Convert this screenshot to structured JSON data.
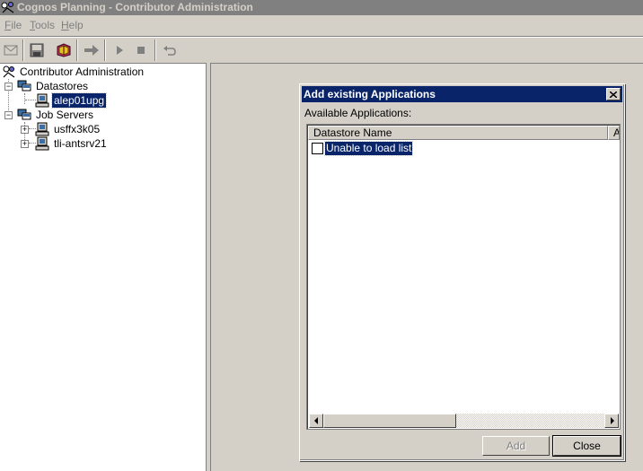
{
  "window": {
    "title": "Cognos Planning - Contributor Administration"
  },
  "menu": {
    "items": [
      {
        "label": "File",
        "accel": "F",
        "rest": "ile"
      },
      {
        "label": "Tools",
        "accel": "T",
        "rest": "ools"
      },
      {
        "label": "Help",
        "accel": "H",
        "rest": "elp"
      }
    ]
  },
  "toolbar": {
    "buttons": [
      "mail-icon",
      "save-icon",
      "book-icon",
      "go-arrow-icon",
      "play-icon",
      "stop-icon",
      "undo-icon"
    ]
  },
  "tree": {
    "root": "Contributor Administration",
    "datastores": "Datastores",
    "datastore_item": "alep01upg",
    "job_servers": "Job Servers",
    "server_1": "usffx3k05",
    "server_2": "tli-antsrv21"
  },
  "dialog": {
    "title": "Add existing Applications",
    "label": "Available Applications:",
    "columns": [
      "Datastore Name",
      "A"
    ],
    "rows": [
      "Unable to load list"
    ],
    "add_label": "Add",
    "close_label": "Close"
  },
  "colors": {
    "selection": "#0a246a",
    "face": "#d4d0c8",
    "inactive_title": "#808080"
  }
}
